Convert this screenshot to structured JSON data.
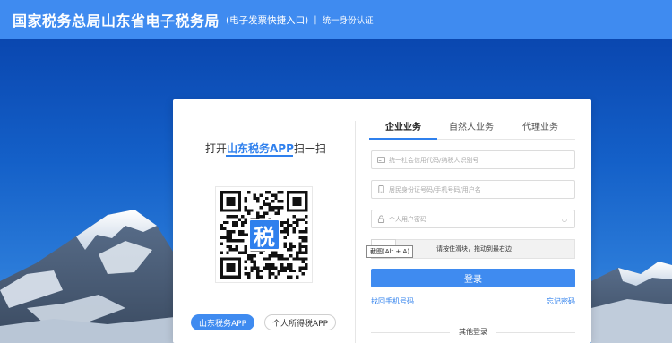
{
  "header": {
    "brand": "国家税务总局山东省电子税务局",
    "subtitle": "(电子发票快捷入口)",
    "separator": "|",
    "auth": "统一身份认证"
  },
  "scan": {
    "prefix": "打开",
    "app": "山东税务APP",
    "suffix": "扫一扫",
    "qr_logo": "税"
  },
  "app_buttons": {
    "primary": "山东税务APP",
    "secondary": "个人所得税APP"
  },
  "tabs": [
    "企业业务",
    "自然人业务",
    "代理业务"
  ],
  "form": {
    "credit_code_placeholder": "统一社会信用代码/纳税人识别号",
    "id_placeholder": "居民身份证号码/手机号码/用户名",
    "password_placeholder": "个人用户密码",
    "password_toggle": "◡",
    "slider_text": "请按住滑块，拖动到最右边",
    "slider_knob": ">>",
    "tooltip": "截图(Alt + A)",
    "login_label": "登录",
    "find_phone": "找回手机号码",
    "forgot_password": "忘记密码",
    "other_login": "其他登录"
  },
  "colors": {
    "header": "#3f8bf0",
    "accent": "#2f80ed",
    "button": "#3f8bf0"
  },
  "icons": {
    "credit_code": "id-card-icon",
    "id_number": "phone-icon",
    "password": "lock-icon",
    "password_toggle": "eye-closed-icon",
    "slider": "double-chevron-right-icon"
  }
}
